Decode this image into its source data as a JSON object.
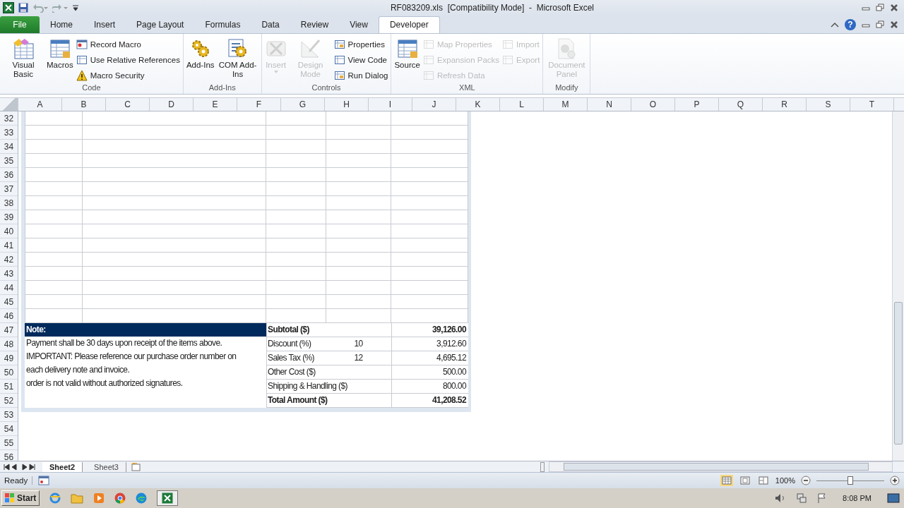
{
  "window": {
    "title": "RF083209.xls  [Compatibility Mode]  -  Microsoft Excel"
  },
  "tabs": [
    {
      "label": "File",
      "kind": "file",
      "selected": false
    },
    {
      "label": "Home",
      "kind": "tab",
      "selected": false
    },
    {
      "label": "Insert",
      "kind": "tab",
      "selected": false
    },
    {
      "label": "Page Layout",
      "kind": "tab",
      "selected": false
    },
    {
      "label": "Formulas",
      "kind": "tab",
      "selected": false
    },
    {
      "label": "Data",
      "kind": "tab",
      "selected": false
    },
    {
      "label": "Review",
      "kind": "tab",
      "selected": false
    },
    {
      "label": "View",
      "kind": "tab",
      "selected": false
    },
    {
      "label": "Developer",
      "kind": "tab",
      "selected": true
    }
  ],
  "help": "?",
  "ribbon": [
    {
      "label": "Code",
      "items": [
        {
          "label": "Visual Basic",
          "kind": "large",
          "disabled": false
        },
        {
          "label": "Macros",
          "kind": "large",
          "disabled": false
        },
        {
          "label": "Record Macro",
          "kind": "small",
          "disabled": false
        },
        {
          "label": "Use Relative References",
          "kind": "small",
          "disabled": false
        },
        {
          "label": "Macro Security",
          "kind": "small",
          "disabled": false
        }
      ]
    },
    {
      "label": "Add-Ins",
      "items": [
        {
          "label": "Add-Ins",
          "kind": "large",
          "disabled": false
        },
        {
          "label": "COM Add-Ins",
          "kind": "large",
          "disabled": false
        }
      ]
    },
    {
      "label": "Controls",
      "items": [
        {
          "label": "Insert",
          "kind": "dropdown",
          "disabled": true
        },
        {
          "label": "Design Mode",
          "kind": "large",
          "disabled": true
        },
        {
          "label": "Properties",
          "kind": "small",
          "disabled": false
        },
        {
          "label": "View Code",
          "kind": "small",
          "disabled": false
        },
        {
          "label": "Run Dialog",
          "kind": "small",
          "disabled": false
        }
      ]
    },
    {
      "label": "XML",
      "items": [
        {
          "label": "Source",
          "kind": "large",
          "disabled": false
        },
        {
          "label": "Map Properties",
          "kind": "small",
          "disabled": true
        },
        {
          "label": "Expansion Packs",
          "kind": "small",
          "disabled": true
        },
        {
          "label": "Refresh Data",
          "kind": "small",
          "disabled": true
        },
        {
          "label": "Import",
          "kind": "small",
          "disabled": true
        },
        {
          "label": "Export",
          "kind": "small",
          "disabled": true
        }
      ]
    },
    {
      "label": "Modify",
      "items": [
        {
          "label": "Document Panel",
          "kind": "large",
          "disabled": true
        }
      ]
    }
  ],
  "sheet": {
    "columns": [
      "A",
      "B",
      "C",
      "D",
      "E",
      "F",
      "G",
      "H",
      "I",
      "J",
      "K",
      "L",
      "M",
      "N",
      "O",
      "P",
      "Q",
      "R",
      "S",
      "T"
    ],
    "rows": [
      "32",
      "33",
      "34",
      "35",
      "36",
      "37",
      "38",
      "39",
      "40",
      "41",
      "42",
      "43",
      "44",
      "45",
      "46",
      "47",
      "48",
      "49",
      "50",
      "51",
      "52",
      "53",
      "54",
      "55",
      "56"
    ],
    "note": {
      "title": "Note:",
      "lines": [
        "Payment shall be 30 days upon receipt of the items above.",
        "IMPORTANT: Please reference our purchase order number on",
        "each delivery note and invoice.",
        "order is not valid without authorized signatures."
      ]
    },
    "totals": [
      {
        "label": "Subtotal ($)",
        "kind": "bold",
        "value": "39,126.00"
      },
      {
        "label": "Discount (%)",
        "kind": "plain",
        "rate": "10",
        "value": "3,912.60"
      },
      {
        "label": "Sales Tax (%)",
        "kind": "plain",
        "rate": "12",
        "value": "4,695.12"
      },
      {
        "label": "Other Cost ($)",
        "kind": "plain",
        "value": "500.00"
      },
      {
        "label": "Shipping & Handling ($)",
        "kind": "plain",
        "value": "800.00"
      },
      {
        "label": "Total Amount ($)",
        "kind": "bold",
        "value": "41,208.52"
      }
    ]
  },
  "sheet_tabs": [
    {
      "label": "Sheet2",
      "selected": true
    },
    {
      "label": "Sheet3",
      "selected": false
    }
  ],
  "status": {
    "text": "Ready",
    "zoom": "100%",
    "level": 0.5
  },
  "taskbar": {
    "start": "Start",
    "time": "8:08 PM"
  }
}
